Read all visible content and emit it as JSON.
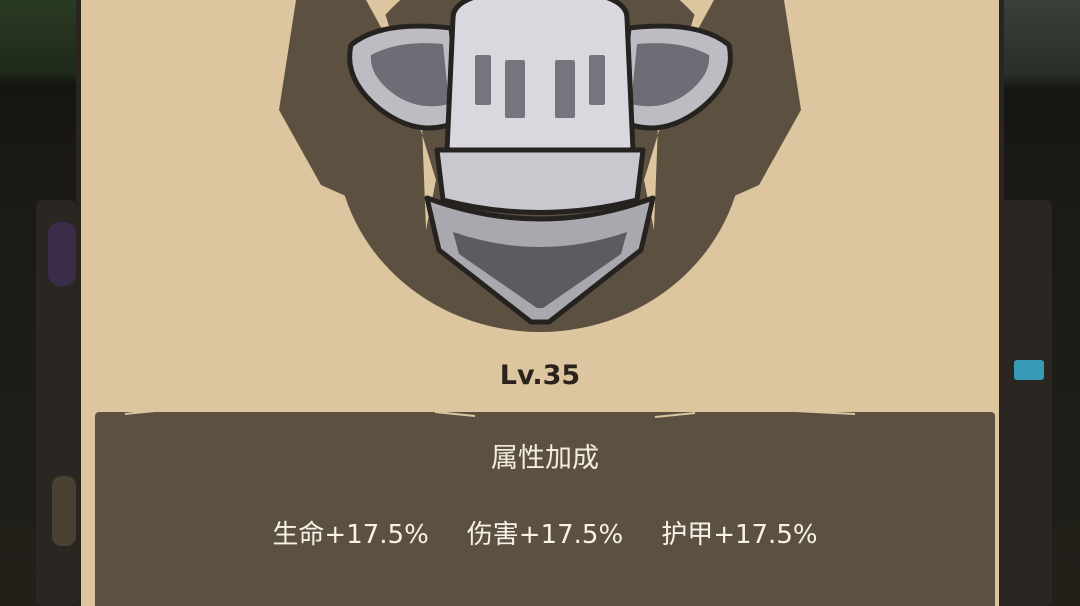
{
  "panel": {
    "level_label": "Lv.35",
    "bonus": {
      "title": "属性加成",
      "stats": [
        {
          "label": "生命+17.5%"
        },
        {
          "label": "伤害+17.5%"
        },
        {
          "label": "护甲+17.5%"
        }
      ]
    },
    "emblem_icon": "knight-helmet-icon"
  },
  "colors": {
    "panel_bg": "#dcc59f",
    "emblem_bg": "#5c5140",
    "text_dark": "#2a221b",
    "text_light": "#f3ece0"
  }
}
